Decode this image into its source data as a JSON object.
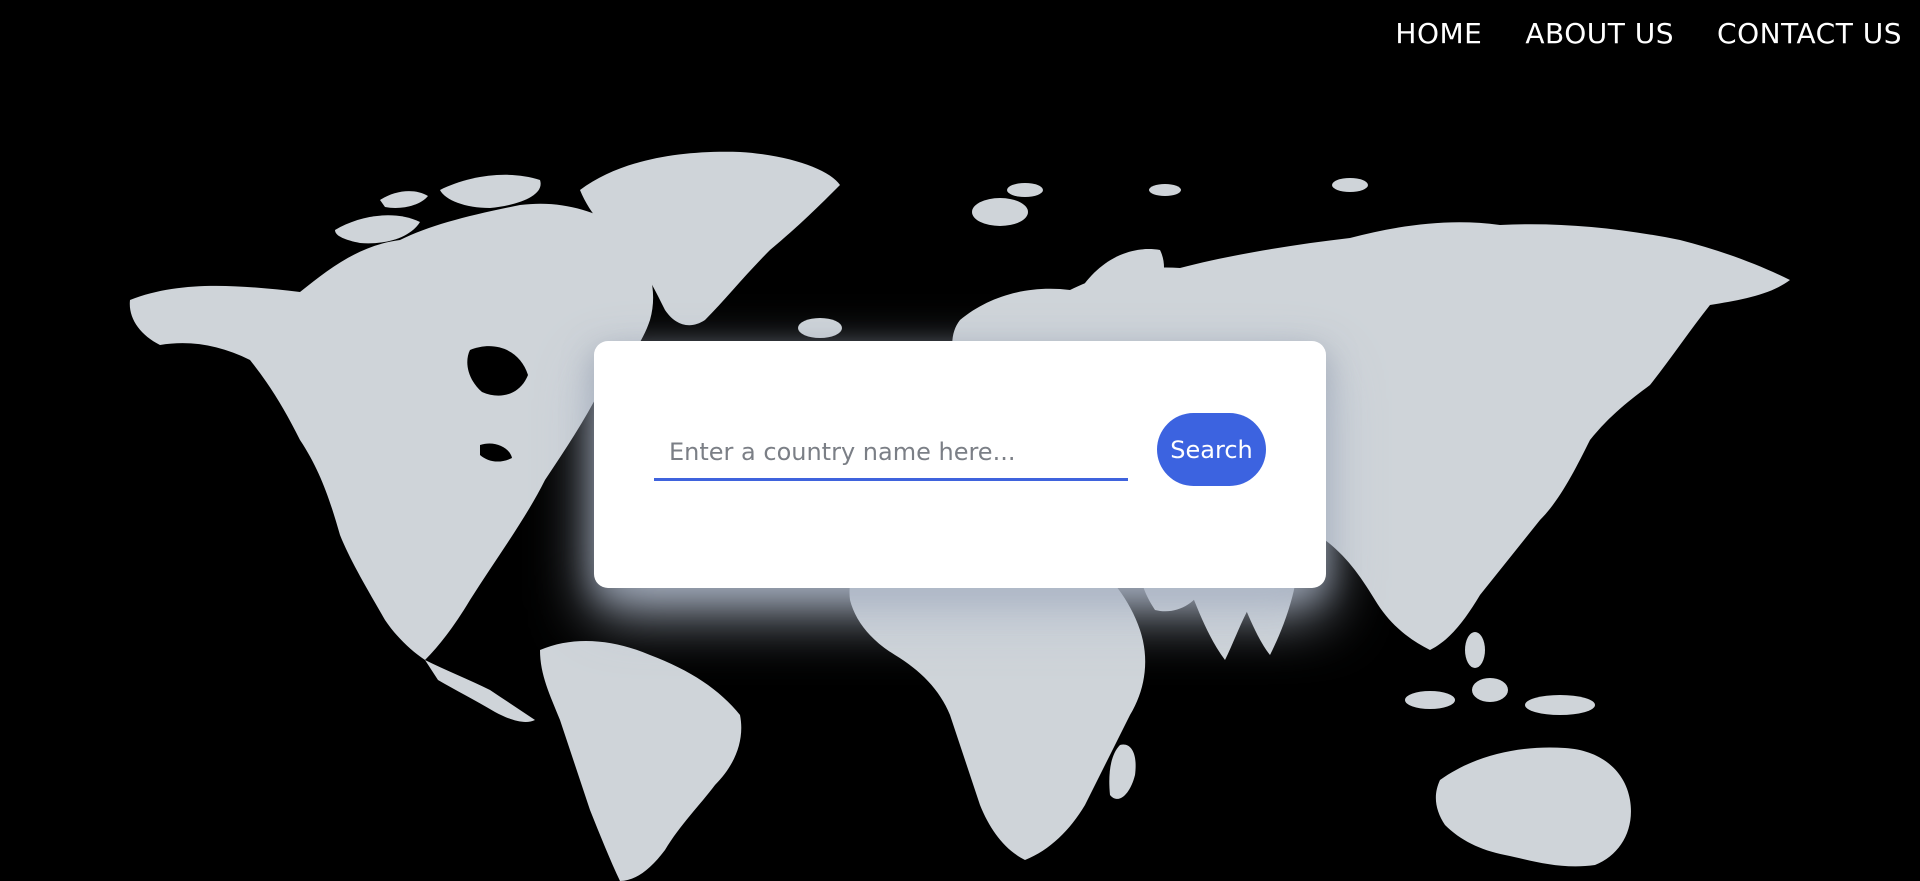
{
  "nav": {
    "items": [
      {
        "label": "HOME"
      },
      {
        "label": "ABOUT US"
      },
      {
        "label": "CONTACT US"
      }
    ]
  },
  "search": {
    "placeholder": "Enter a country name here...",
    "value": "",
    "button_label": "Search"
  },
  "colors": {
    "background": "#000000",
    "landmass": "#cfd4d9",
    "accent": "#3c63e0",
    "card": "#ffffff"
  }
}
